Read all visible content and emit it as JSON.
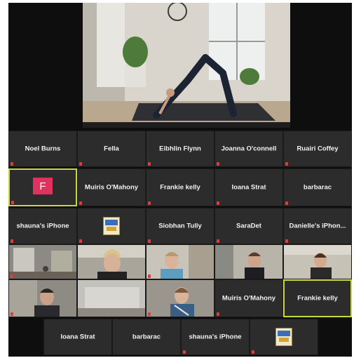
{
  "grid": {
    "row1": [
      "Noel Burns",
      "Fella",
      "Eibhlin Flynn",
      "Joanna O'connell",
      "Ruairi Coffey"
    ],
    "row2": [
      "",
      "Muiris O'Mahony",
      "Frankie kelly",
      "Ioana Strat",
      "barbarac"
    ],
    "row3": [
      "shauna's iPhone",
      "",
      "Siobhan Tully",
      "SaraDet",
      "Danielle's iPhon..."
    ],
    "row5_names": [
      "Muiris O'Mahony",
      "Frankie kelly"
    ],
    "row6": [
      "Ioana Strat",
      "barbarac",
      "shauna's iPhone"
    ]
  },
  "avatar_letter": "F",
  "colors": {
    "accent_border": "#c8d73c",
    "avatar_bg": "#e0325f",
    "mic_muted": "#e23b3b"
  }
}
